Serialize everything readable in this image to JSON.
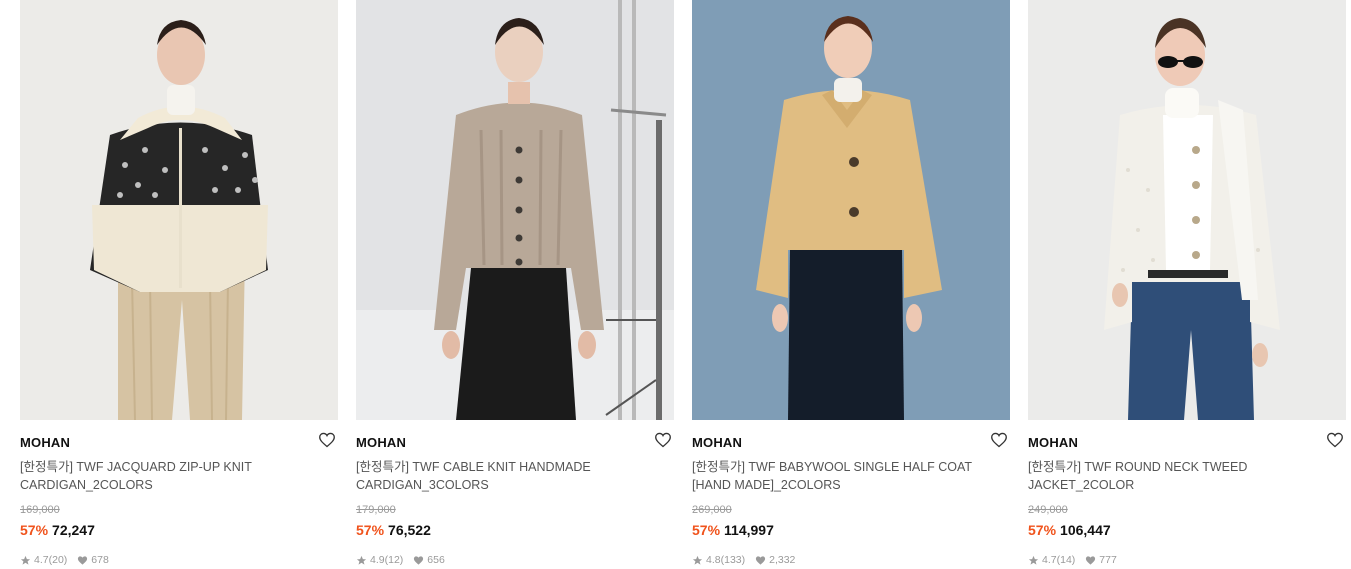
{
  "products": [
    {
      "brand": "MOHAN",
      "title_line1": "[한정특가] TWF JACQUARD ZIP-UP KNIT",
      "title_line2": "CARDIGAN_2COLORS",
      "original_price": "169,000",
      "discount": "57%",
      "price": "72,247",
      "rating": "4.7",
      "reviews": "(20)",
      "likes": "678"
    },
    {
      "brand": "MOHAN",
      "title_line1": "[한정특가] TWF CABLE KNIT HANDMADE",
      "title_line2": "CARDIGAN_3COLORS",
      "original_price": "179,000",
      "discount": "57%",
      "price": "76,522",
      "rating": "4.9",
      "reviews": "(12)",
      "likes": "656"
    },
    {
      "brand": "MOHAN",
      "title_line1": "[한정특가] TWF BABYWOOL SINGLE HALF COAT",
      "title_line2": "[HAND MADE]_2COLORS",
      "original_price": "269,000",
      "discount": "57%",
      "price": "114,997",
      "rating": "4.8",
      "reviews": "(133)",
      "likes": "2,332"
    },
    {
      "brand": "MOHAN",
      "title_line1": "[한정특가] TWF ROUND NECK TWEED",
      "title_line2": "JACKET_2COLOR",
      "original_price": "249,000",
      "discount": "57%",
      "price": "106,447",
      "rating": "4.7",
      "reviews": "(14)",
      "likes": "777"
    }
  ],
  "icons": {
    "wishlist": "heart-outline-icon",
    "rating": "star-icon",
    "likes": "heart-filled-icon"
  },
  "colors": {
    "discount": "#f0531c",
    "muted": "#9a9a9a",
    "title": "#555555"
  }
}
